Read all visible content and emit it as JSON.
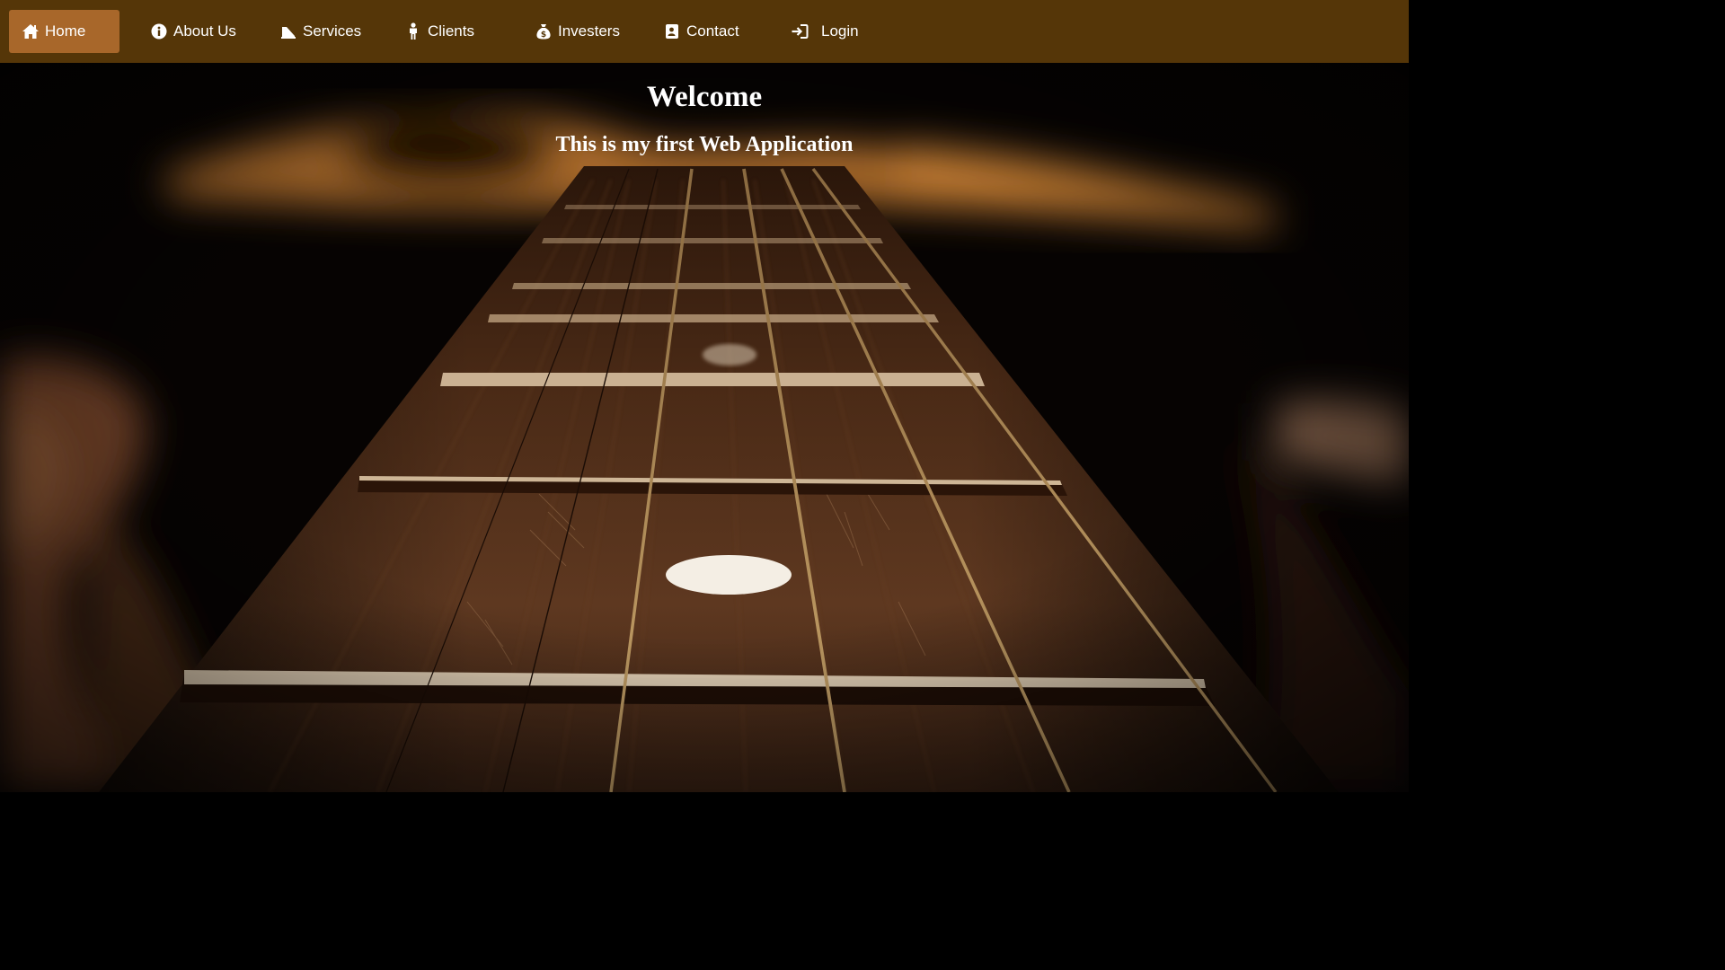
{
  "nav": {
    "items": [
      {
        "label": "Home",
        "icon": "home-icon",
        "active": true
      },
      {
        "label": "About Us",
        "icon": "info-icon",
        "active": false
      },
      {
        "label": "Services",
        "icon": "services-icon",
        "active": false
      },
      {
        "label": "Clients",
        "icon": "person-icon",
        "active": false
      },
      {
        "label": "Investers",
        "icon": "money-bag-icon",
        "active": false
      },
      {
        "label": "Contact",
        "icon": "contact-card-icon",
        "active": false
      },
      {
        "label": "Login",
        "icon": "sign-in-icon",
        "active": false
      }
    ]
  },
  "hero": {
    "title": "Welcome",
    "subtitle": "This is my first Web Application",
    "background_image": "guitar-fretboard-photo"
  },
  "colors": {
    "navbar_bg": "#553608",
    "active_item_bg": "#a8672a",
    "text": "#ffffff"
  }
}
